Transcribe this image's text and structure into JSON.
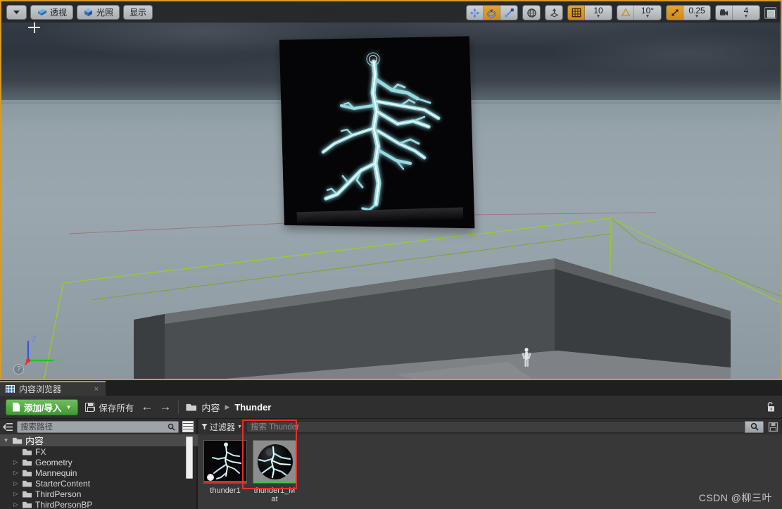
{
  "viewport": {
    "toolbar_left": [
      {
        "name": "viewport-options",
        "label": "",
        "icon": "chevron-down-icon"
      },
      {
        "name": "view-perspective",
        "label": "透视",
        "icon": "perspective-icon"
      },
      {
        "name": "view-lit",
        "label": "光照",
        "icon": "lit-cube-icon"
      },
      {
        "name": "view-show",
        "label": "显示",
        "icon": "show-icon"
      }
    ],
    "toolbar_right": {
      "gizmo_group": [
        {
          "name": "translate-mode",
          "icon": "move-gizmo-icon",
          "active": false
        },
        {
          "name": "rotate-mode",
          "icon": "rotate-gizmo-icon",
          "active": true
        },
        {
          "name": "scale-mode",
          "icon": "scale-gizmo-icon",
          "active": false
        }
      ],
      "coord_space": {
        "name": "world-space-toggle",
        "icon": "globe-icon"
      },
      "surface_snap": {
        "name": "surface-snap-toggle",
        "icon": "surface-snap-icon"
      },
      "grid_snap": {
        "name": "grid-snap-toggle",
        "icon": "grid-icon",
        "active": true,
        "value": "10"
      },
      "angle_snap": {
        "name": "angle-snap-toggle",
        "icon": "angle-icon",
        "active": false,
        "value": "10°"
      },
      "scale_snap": {
        "name": "scale-snap-toggle",
        "icon": "scale-snap-icon",
        "active": true,
        "value": "0.25"
      },
      "camera_speed": {
        "name": "camera-speed",
        "icon": "camera-icon",
        "value": "4"
      },
      "maximize": {
        "name": "maximize-viewport-button",
        "icon": "maximize-icon"
      }
    },
    "axis_gizmo": {
      "z": "Z",
      "y": "Y",
      "x": "X",
      "help": "?"
    },
    "scene": {
      "plane_name": "lightning-plane",
      "mesh_name": "lightning-bolt-mesh",
      "actor_name": "mannequin-actor"
    },
    "border_color": "#d79b28"
  },
  "content_browser": {
    "tab": {
      "label": "内容浏览器",
      "close": "×",
      "icon": "content-browser-icon"
    },
    "toolbar": {
      "add_import_label": "添加/导入",
      "add_import_caret": "▼",
      "save_all_label": "保存所有",
      "back_arrow": "←",
      "forward_arrow": "→",
      "breadcrumb": [
        "内容",
        "Thunder"
      ],
      "breadcrumb_sep": "▶",
      "lock_icon": "unlock-icon"
    },
    "tree": {
      "search_placeholder": "搜索路径",
      "items": [
        {
          "label": "内容",
          "depth": 0,
          "expanded": true,
          "expander": "▼",
          "selected": true
        },
        {
          "label": "FX",
          "depth": 1,
          "expanded": false,
          "expander": ""
        },
        {
          "label": "Geometry",
          "depth": 1,
          "expanded": false,
          "expander": "▷"
        },
        {
          "label": "Mannequin",
          "depth": 1,
          "expanded": false,
          "expander": "▷"
        },
        {
          "label": "StarterContent",
          "depth": 1,
          "expanded": false,
          "expander": "▷"
        },
        {
          "label": "ThirdPerson",
          "depth": 1,
          "expanded": false,
          "expander": "▷"
        },
        {
          "label": "ThirdPersonBP",
          "depth": 1,
          "expanded": false,
          "expander": "▷"
        }
      ]
    },
    "assets": {
      "filter_label": "过滤器",
      "filter_caret": "▼",
      "search_placeholder": "搜索 Thunder",
      "items": [
        {
          "name": "thunder1",
          "type": "texture",
          "bar_color": "#c0392b",
          "selected": false
        },
        {
          "name": "thunder1_Mat",
          "type": "material",
          "bar_color": "#3fc43f",
          "selected": true
        }
      ],
      "selection_outline_color": "#e8302c"
    }
  },
  "watermark": "CSDN @柳三叶"
}
